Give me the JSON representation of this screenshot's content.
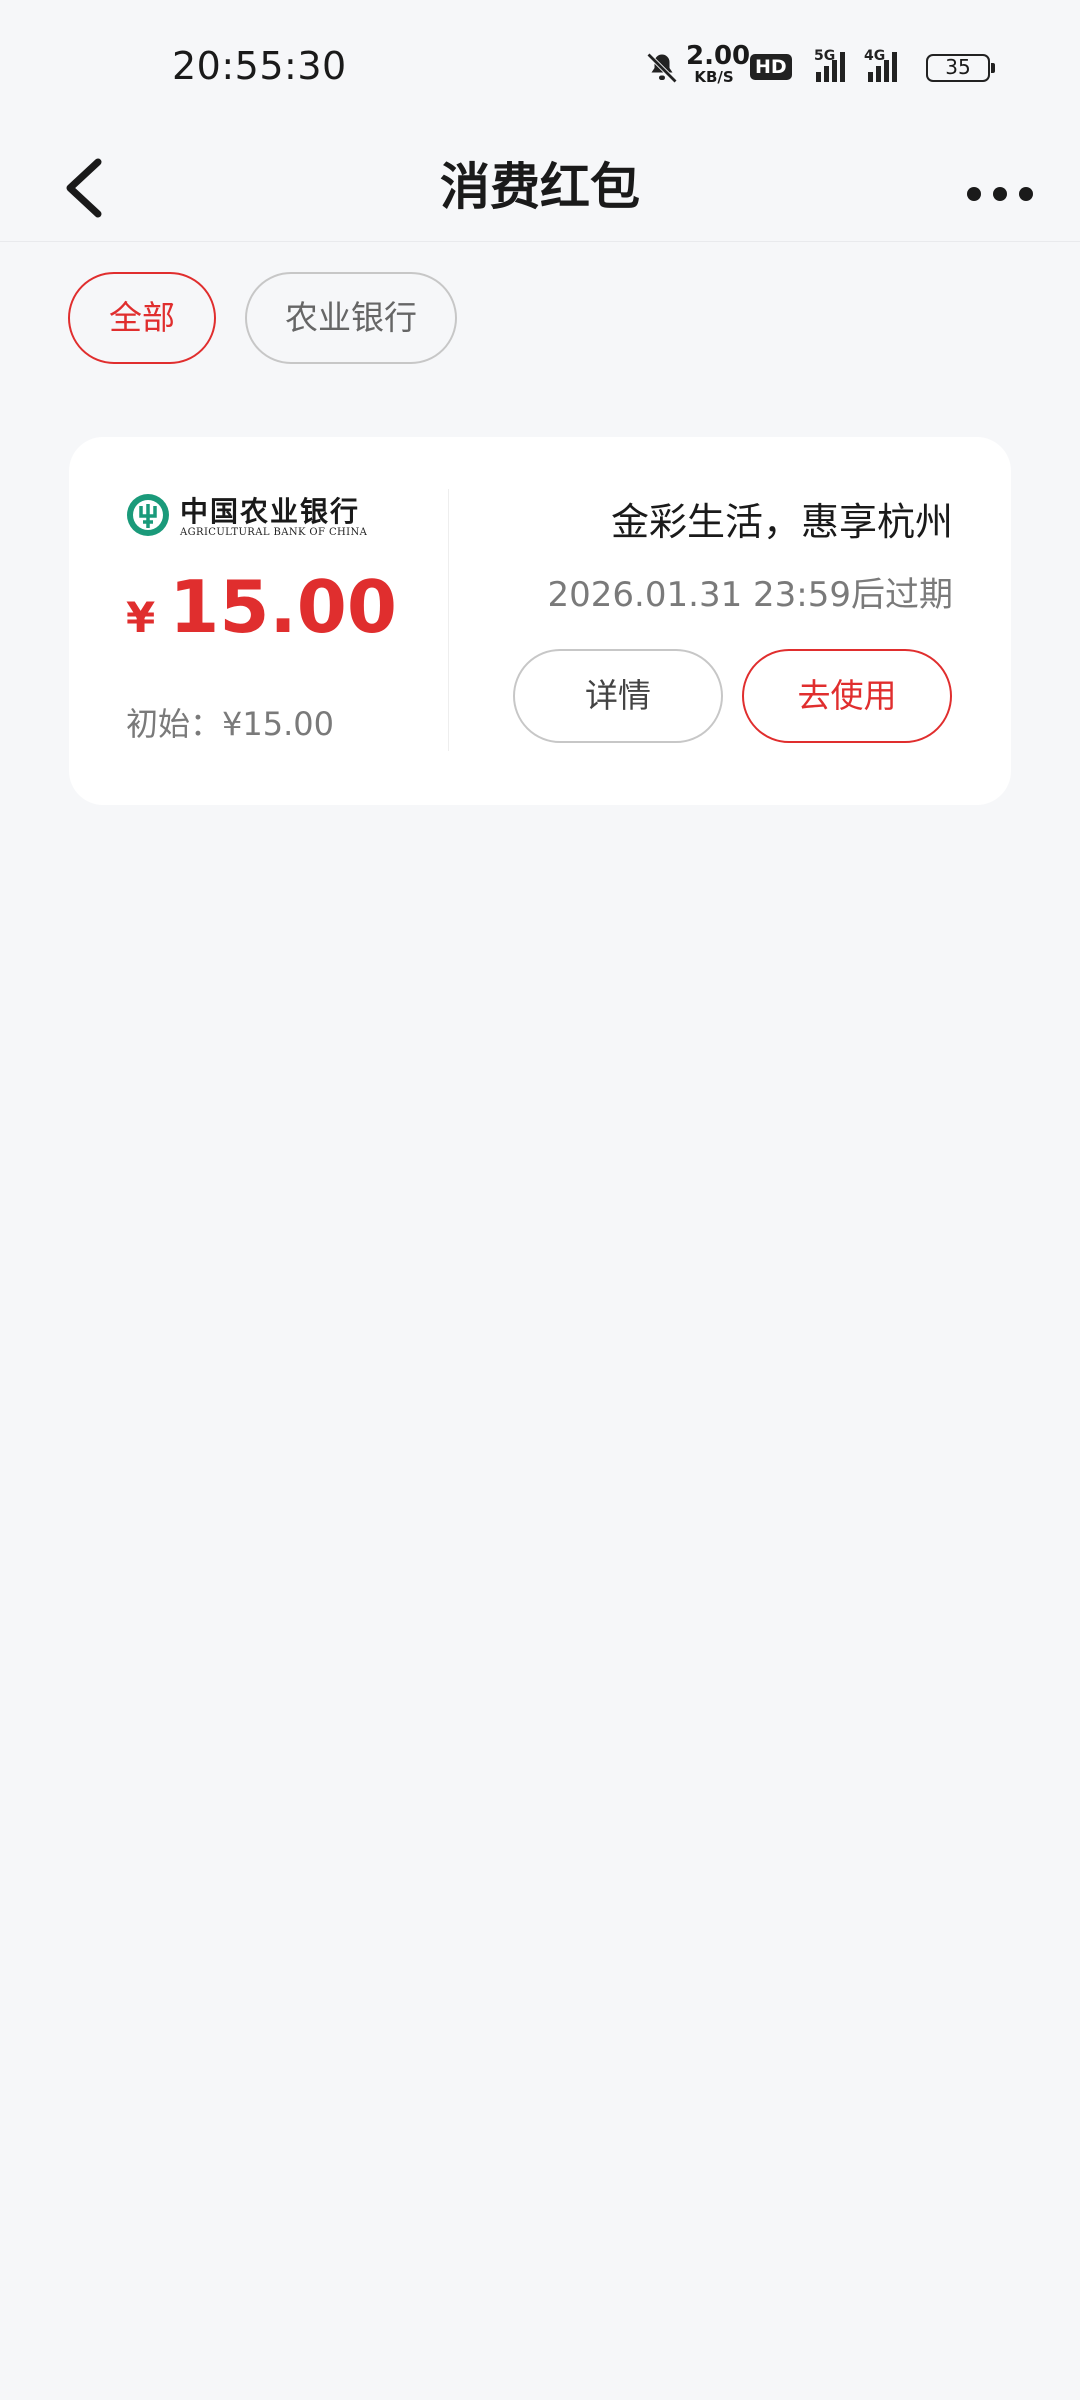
{
  "status_bar": {
    "time": "20:55:30",
    "net_speed_value": "2.00",
    "net_speed_unit": "KB/S",
    "hd_label": "HD",
    "signal1_label": "5G",
    "signal2_label": "4G",
    "battery": "35",
    "icons": [
      "mute-bell-icon",
      "signal-5g-icon",
      "signal-4g-icon",
      "battery-icon"
    ]
  },
  "nav": {
    "title": "消费红包",
    "icons": [
      "chevron-left-icon",
      "more-dots-icon"
    ]
  },
  "filters": [
    {
      "label": "全部",
      "active": true
    },
    {
      "label": "农业银行",
      "active": false
    }
  ],
  "cards": [
    {
      "bank_name_cn": "中国农业银行",
      "bank_name_en": "AGRICULTURAL BANK OF CHINA",
      "currency_symbol": "¥",
      "amount": "15.00",
      "initial_label": "初始：¥15.00",
      "title": "金彩生活，惠享杭州",
      "expiry": "2026.01.31 23:59后过期",
      "detail_label": "详情",
      "use_label": "去使用"
    }
  ],
  "colors": {
    "accent": "#e02e2e",
    "background": "#f6f7f9",
    "card": "#ffffff",
    "abc_green": "#1a9a7a"
  }
}
